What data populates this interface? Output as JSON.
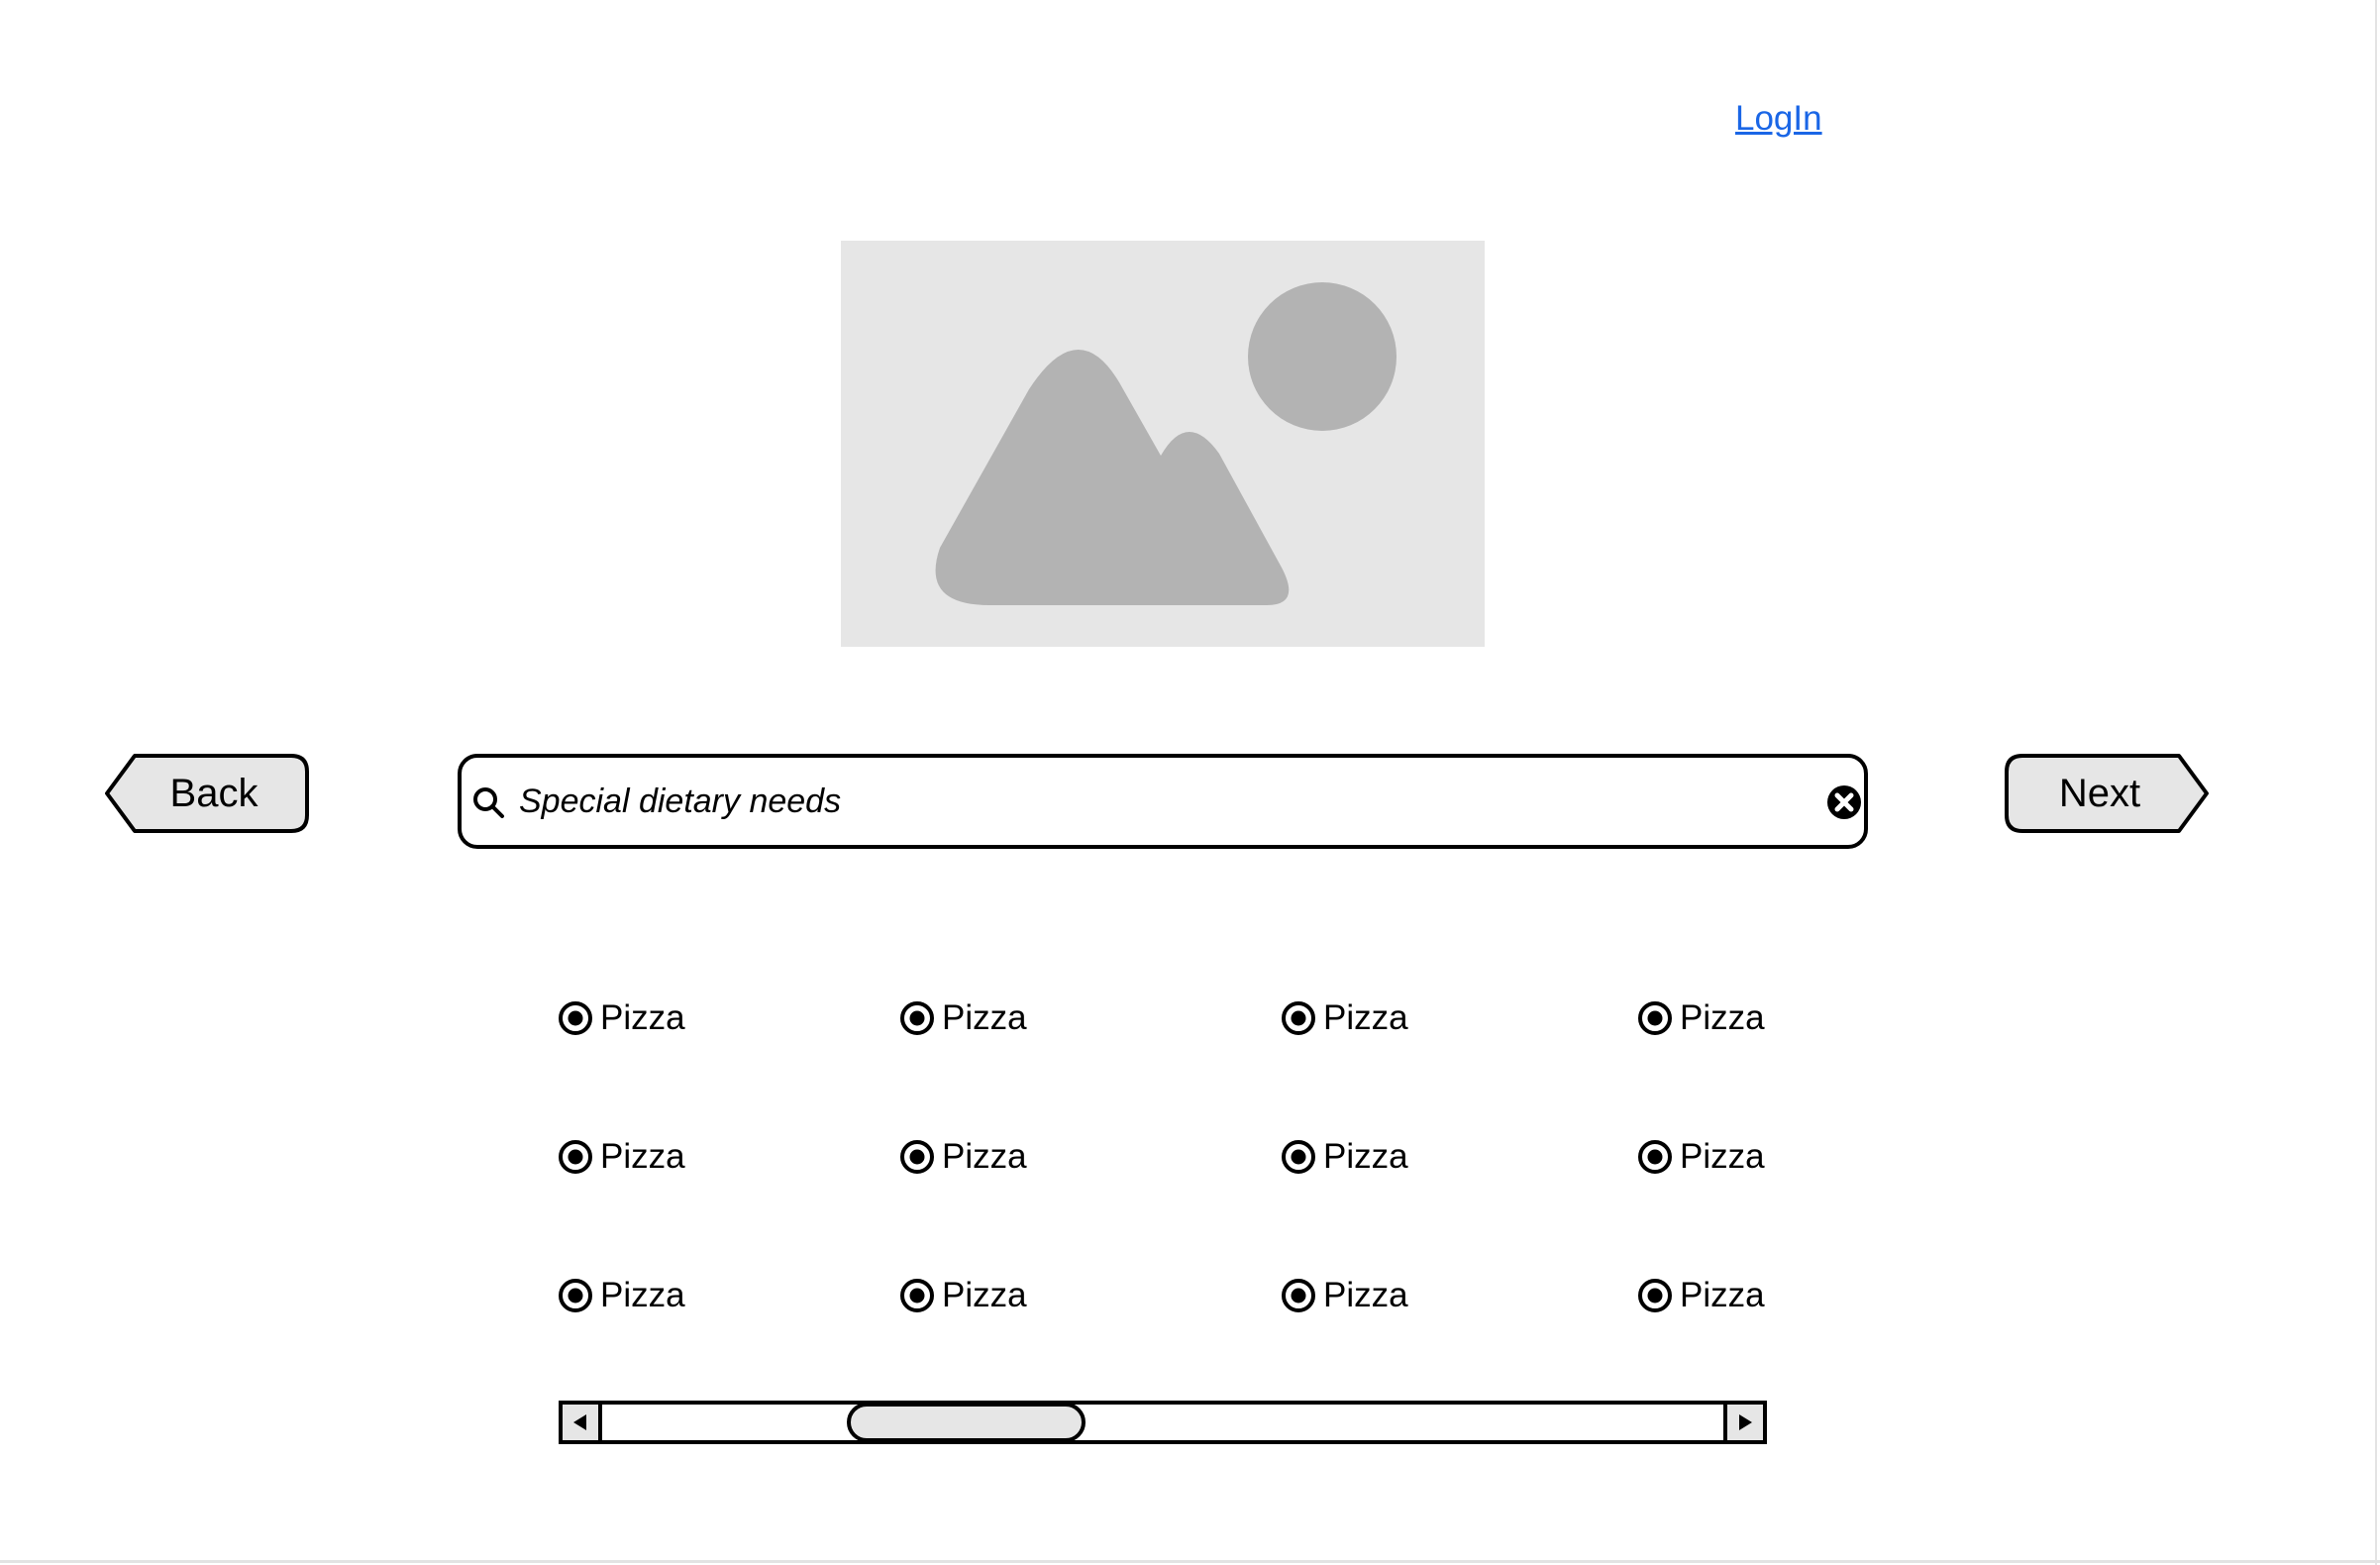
{
  "header": {
    "login_label": "LogIn",
    "link_color": "#1a66e6"
  },
  "hero": {
    "icon": "image-placeholder-icon",
    "background_color": "#e6e6e6",
    "shape_color": "#b3b3b3"
  },
  "navigation": {
    "back_label": "Back",
    "next_label": "Next",
    "button_fill": "#e6e6e6"
  },
  "search": {
    "placeholder": "Special dietary needs",
    "value": "",
    "icons": [
      "search-icon",
      "clear-icon"
    ]
  },
  "options": {
    "rows": [
      [
        "Pizza",
        "Pizza",
        "Pizza",
        "Pizza"
      ],
      [
        "Pizza",
        "Pizza",
        "Pizza",
        "Pizza"
      ],
      [
        "Pizza",
        "Pizza",
        "Pizza",
        "Pizza"
      ]
    ],
    "selected": true
  },
  "scrollbar": {
    "thumb_start_fraction": 0.218,
    "thumb_size_fraction": 0.213,
    "icons": [
      "arrow-left-icon",
      "arrow-right-icon"
    ]
  }
}
